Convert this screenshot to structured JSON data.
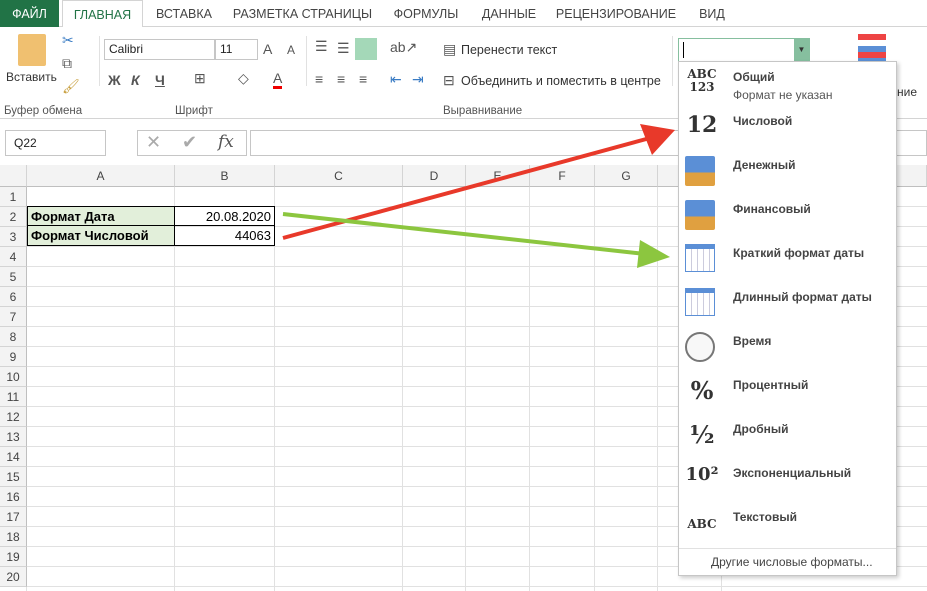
{
  "tabs": [
    "ФАЙЛ",
    "ГЛАВНАЯ",
    "ВСТАВКА",
    "РАЗМЕТКА СТРАНИЦЫ",
    "ФОРМУЛЫ",
    "ДАННЫЕ",
    "РЕЦЕНЗИРОВАНИЕ",
    "ВИД"
  ],
  "ribbon": {
    "paste": "Вставить",
    "clipboard": "Буфер обмена",
    "font_name": "Calibri",
    "font_size": "11",
    "font": "Шрифт",
    "bold": "Ж",
    "italic": "К",
    "underline": "Ч",
    "wrap": "Перенести текст",
    "merge": "Объединить и поместить в центре",
    "alignment": "Выравнивание",
    "number_format_value": "",
    "cond_partial": "ние"
  },
  "formula_bar": {
    "name_box": "Q22",
    "fx": "fx",
    "value": ""
  },
  "columns": [
    "A",
    "B",
    "C",
    "D",
    "E",
    "F",
    "G"
  ],
  "rows": [
    "1",
    "2",
    "3",
    "4",
    "5",
    "6",
    "7",
    "8",
    "9",
    "10",
    "11",
    "12",
    "13",
    "14",
    "15",
    "16",
    "17",
    "18",
    "19",
    "20"
  ],
  "cells": {
    "A2": "Формат Дата",
    "B2": "20.08.2020",
    "A3": "Формат Числовой",
    "B3": "44063"
  },
  "colors": {
    "accent": "#217346",
    "label_fill": "#e2efda",
    "red_arrow": "#e8392a",
    "green_arrow": "#8cc63f"
  },
  "dropdown": {
    "items": [
      {
        "icon": "abc-123-icon",
        "glyph": "ABC 123",
        "label": "Общий",
        "sub": "Формат не указан"
      },
      {
        "icon": "number-12-icon",
        "glyph": "12",
        "label": "Числовой"
      },
      {
        "icon": "currency-icon",
        "glyph": "",
        "label": "Денежный"
      },
      {
        "icon": "accounting-icon",
        "glyph": "",
        "label": "Финансовый"
      },
      {
        "icon": "calendar-icon",
        "glyph": "",
        "label": "Краткий формат даты"
      },
      {
        "icon": "calendar-long-icon",
        "glyph": "",
        "label": "Длинный формат даты"
      },
      {
        "icon": "clock-icon",
        "glyph": "",
        "label": "Время"
      },
      {
        "icon": "percent-icon",
        "glyph": "%",
        "label": "Процентный"
      },
      {
        "icon": "fraction-icon",
        "glyph": "½",
        "label": "Дробный"
      },
      {
        "icon": "exponent-icon",
        "glyph": "10²",
        "label": "Экспоненциальный"
      },
      {
        "icon": "text-abc-icon",
        "glyph": "ABC",
        "label": "Текстовый"
      }
    ],
    "more": "Другие числовые форматы..."
  }
}
